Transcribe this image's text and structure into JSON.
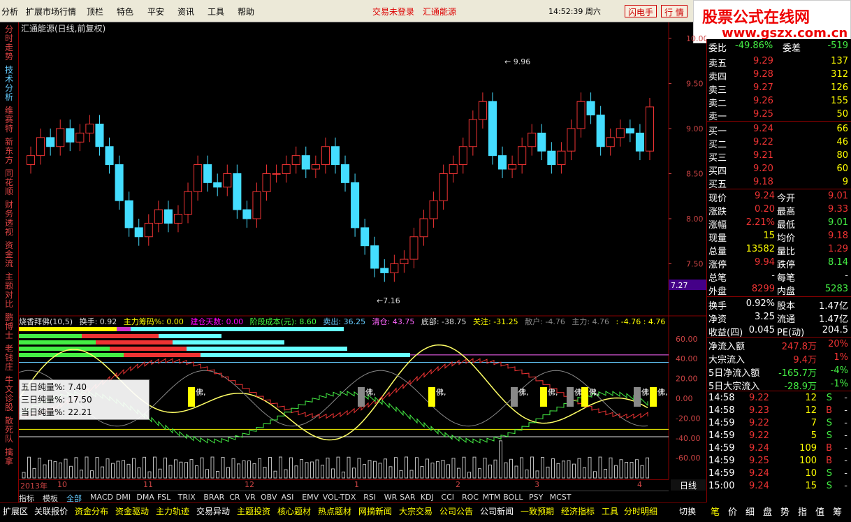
{
  "menu": [
    "分析",
    "扩展市场行情",
    "顶栏",
    "特色",
    "平安",
    "资讯",
    "工具",
    "帮助"
  ],
  "status": {
    "login": "交易未登录",
    "stock": "汇通能源",
    "clock": "14:52:39 周六",
    "btn1": "闪电手",
    "btn2": "行 情"
  },
  "watermark": {
    "line1": "股票公式在线网",
    "line2": "www.gszx.com.cn"
  },
  "sidebar": [
    {
      "label": "分时走势",
      "active": false
    },
    {
      "label": "技术分析",
      "active": true
    },
    {
      "label": "维赛特",
      "active": false
    },
    {
      "label": "新东方",
      "active": false
    },
    {
      "label": "同花顺",
      "active": false
    },
    {
      "label": "财务透视",
      "active": false
    },
    {
      "label": "资金流",
      "active": false
    },
    {
      "label": "主题对比",
      "active": false
    },
    {
      "label": "鹏博士",
      "active": false
    },
    {
      "label": "老钱庄",
      "active": false
    },
    {
      "label": "牛文诊股",
      "active": false
    },
    {
      "label": "散死队",
      "active": false
    },
    {
      "label": "擒拿",
      "active": false
    }
  ],
  "chart": {
    "title": "汇通能源(日线,前复权)",
    "price_ticks": [
      "10.00",
      "9.50",
      "9.00",
      "8.50",
      "8.00",
      "7.50"
    ],
    "high_label": "9.96",
    "low_label": "7.16",
    "cursor_price": "7.27",
    "ind_ticks": [
      "60.00",
      "40.00",
      "20.00",
      "0.00",
      "-20.00",
      "-40.00",
      "-60.00"
    ],
    "buddha_label": "佛,"
  },
  "chart_data": {
    "type": "candlestick",
    "title": "汇通能源(日线,前复权)",
    "ylim": [
      7.0,
      10.1
    ],
    "values": [
      8.7,
      8.9,
      8.8,
      9.0,
      8.85,
      8.95,
      9.05,
      8.8,
      8.6,
      8.2,
      7.9,
      7.8,
      7.95,
      8.1,
      7.95,
      8.05,
      8.3,
      8.6,
      8.4,
      8.35,
      8.5,
      8.1,
      8.0,
      8.3,
      8.5,
      8.5,
      8.6,
      8.7,
      8.55,
      8.6,
      8.8,
      8.6,
      8.4,
      7.9,
      7.7,
      7.45,
      7.4,
      7.5,
      7.55,
      7.8,
      8.0,
      8.2,
      8.5,
      8.6,
      8.8,
      9.1,
      9.3,
      8.7,
      8.55,
      8.6,
      8.8,
      8.95,
      8.75,
      8.6,
      8.75,
      9.0,
      9.3,
      9.15,
      8.8,
      8.9,
      9.0,
      8.95,
      8.75,
      9.24
    ],
    "high": "9.96",
    "low": "7.16"
  },
  "indicator": {
    "name": "烧香拜佛(10,5)",
    "huanshou": "换手: 0.92",
    "zhuli": "主力筹码%: 0.00",
    "jiancang": "建仓天数: 0.00",
    "jieduan": "阶段成本(元): 8.60",
    "maichu": "卖出: 36.25",
    "qingcang": "清仓: 43.75",
    "dibu": "底部: -38.75",
    "guanzhu": "关注: -31.25",
    "sanhu": "散户: -4.76",
    "zhuli2": "主力: 4.76",
    "extra": ": -4.76 : 4.76"
  },
  "infobox": {
    "wu": "五日纯量%: 7.40",
    "san": "三日纯量%: 17.50",
    "dang": "当日纯量%: 22.21"
  },
  "dates": [
    "2013年",
    "10",
    "11",
    "12",
    "1",
    "2",
    "3",
    "4"
  ],
  "period": "日线",
  "ind_tabs": [
    "指标",
    "模板",
    "全部",
    "MACD",
    "DMI",
    "DMA",
    "FSL",
    "TRIX",
    "BRAR",
    "CR",
    "VR",
    "OBV",
    "ASI",
    "EMV",
    "VOL-TDX",
    "RSI",
    "WR",
    "SAR",
    "KDJ",
    "CCI",
    "ROC",
    "MTM",
    "BOLL",
    "PSY",
    "MCST"
  ],
  "bottom_tabs": [
    "扩展区",
    "关联报价",
    "资金分布",
    "资金驱动",
    "主力轨迹",
    "交易异动",
    "主题投资",
    "核心题材",
    "热点题材",
    "网摘新闻",
    "大宗交易",
    "公司公告",
    "公司新闻",
    "一致预期",
    "经济指标",
    "工具",
    "分时明细",
    "切换"
  ],
  "quote": {
    "weibi": {
      "label": "委比",
      "value": "-49.86%",
      "label2": "委差",
      "value2": "-519"
    },
    "asks": [
      {
        "label": "卖五",
        "price": "9.29",
        "vol": "137"
      },
      {
        "label": "卖四",
        "price": "9.28",
        "vol": "312"
      },
      {
        "label": "卖三",
        "price": "9.27",
        "vol": "126"
      },
      {
        "label": "卖二",
        "price": "9.26",
        "vol": "155"
      },
      {
        "label": "卖一",
        "price": "9.25",
        "vol": "50"
      }
    ],
    "bids": [
      {
        "label": "买一",
        "price": "9.24",
        "vol": "66"
      },
      {
        "label": "买二",
        "price": "9.22",
        "vol": "46"
      },
      {
        "label": "买三",
        "price": "9.21",
        "vol": "80"
      },
      {
        "label": "买四",
        "price": "9.20",
        "vol": "60"
      },
      {
        "label": "买五",
        "price": "9.18",
        "vol": "9"
      }
    ],
    "stats": [
      {
        "l1": "现价",
        "v1": "9.24",
        "l2": "今开",
        "v2": "9.01"
      },
      {
        "l1": "涨跌",
        "v1": "0.20",
        "l2": "最高",
        "v2": "9.33"
      },
      {
        "l1": "涨幅",
        "v1": "2.21%",
        "l2": "最低",
        "v2": "9.01"
      },
      {
        "l1": "现量",
        "v1": "15",
        "l2": "均价",
        "v2": "9.18"
      },
      {
        "l1": "总量",
        "v1": "13582",
        "l2": "量比",
        "v2": "1.29"
      },
      {
        "l1": "涨停",
        "v1": "9.94",
        "l2": "跌停",
        "v2": "8.14"
      },
      {
        "l1": "总笔",
        "v1": "-",
        "l2": "每笔",
        "v2": "-"
      },
      {
        "l1": "外盘",
        "v1": "8299",
        "l2": "内盘",
        "v2": "5283"
      }
    ],
    "fund": [
      {
        "l1": "换手",
        "v1": "0.92%",
        "l2": "股本",
        "v2": "1.47亿"
      },
      {
        "l1": "净资",
        "v1": "3.25",
        "l2": "流通",
        "v2": "1.47亿"
      },
      {
        "l1": "收益(四)",
        "v1": "0.045",
        "l2": "PE(动)",
        "v2": "204.5"
      }
    ],
    "flows": [
      {
        "label": "净流入额",
        "value": "247.8万",
        "pct": "20%"
      },
      {
        "label": "大宗流入",
        "value": "9.4万",
        "pct": "1%"
      },
      {
        "label": "5日净流入额",
        "value": "-165.7万",
        "pct": "-4%"
      },
      {
        "label": "5日大宗流入",
        "value": "-28.9万",
        "pct": "-1%"
      }
    ],
    "ticks": [
      {
        "time": "14:58",
        "price": "9.22",
        "vol": "12",
        "side": "S",
        "x": "-"
      },
      {
        "time": "14:58",
        "price": "9.23",
        "vol": "12",
        "side": "B",
        "x": "-"
      },
      {
        "time": "14:59",
        "price": "9.22",
        "vol": "7",
        "side": "S",
        "x": "-"
      },
      {
        "time": "14:59",
        "price": "9.22",
        "vol": "5",
        "side": "S",
        "x": "-"
      },
      {
        "time": "14:59",
        "price": "9.24",
        "vol": "109",
        "side": "B",
        "x": "-"
      },
      {
        "time": "14:59",
        "price": "9.25",
        "vol": "100",
        "side": "B",
        "x": "-"
      },
      {
        "time": "14:59",
        "price": "9.24",
        "vol": "10",
        "side": "S",
        "x": "-"
      },
      {
        "time": "15:00",
        "price": "9.24",
        "vol": "15",
        "side": "S",
        "x": "-"
      }
    ]
  },
  "right_tabs": [
    "笔",
    "价",
    "细",
    "盘",
    "势",
    "指",
    "值",
    "筹"
  ]
}
